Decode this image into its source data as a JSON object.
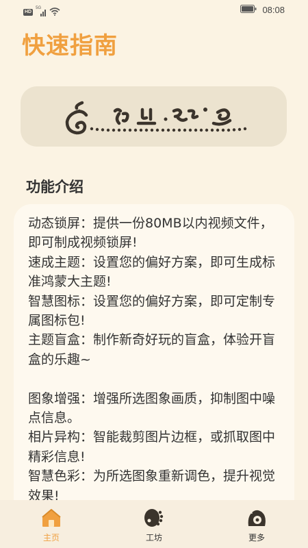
{
  "status_bar": {
    "hd_badge": "HD",
    "network": "5G",
    "time": "08:08"
  },
  "page": {
    "title": "快速指南"
  },
  "section": {
    "title": "功能介绍"
  },
  "intro": {
    "lines": [
      "动态锁屏：提供一份80MB以内视频文件，即可制成视频锁屏!",
      "速成主题：设置您的偏好方案，即可生成标准鸿蒙大主题!",
      "智慧图标：设置您的偏好方案，即可定制专属图标包!",
      "主题盲盒：制作新奇好玩的盲盒，体验开盲盒的乐趣~",
      "",
      "图象增强：增强所选图象画质，抑制图中噪点信息。",
      "相片异构：智能裁剪图片边框，或抓取图中精彩信息!",
      "智慧色彩：为所选图象重新调色，提升视觉效果!"
    ]
  },
  "nav": {
    "items": [
      {
        "label": "主页",
        "icon": "home-icon",
        "active": true
      },
      {
        "label": "工坊",
        "icon": "workshop-icon",
        "active": false
      },
      {
        "label": "更多",
        "icon": "more-icon",
        "active": false
      }
    ]
  },
  "colors": {
    "accent": "#f0a040",
    "background": "#fbf3e3",
    "card": "#ece3cf",
    "nav": "#f7eedf"
  }
}
